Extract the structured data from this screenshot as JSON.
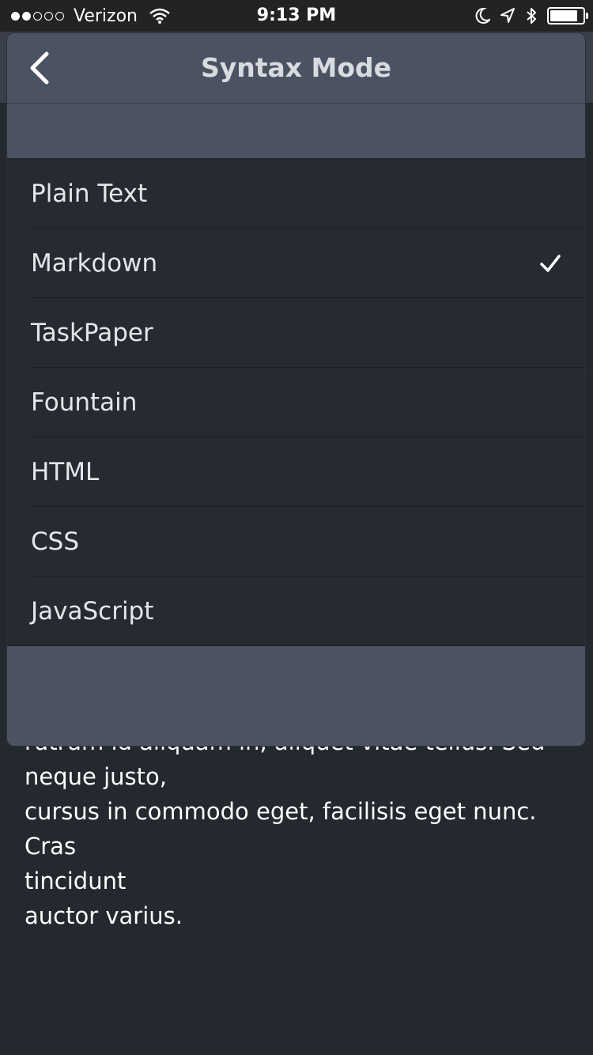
{
  "status_bar": {
    "carrier": "Verizon",
    "time": "9:13 PM",
    "signal_bars_filled": 2,
    "signal_bars_total": 5,
    "icons": [
      "wifi-icon",
      "moon-icon",
      "location-icon",
      "bluetooth-icon",
      "battery-icon"
    ]
  },
  "popover": {
    "title": "Syntax Mode",
    "back_icon": "chevron-left-icon",
    "options": [
      {
        "label": "Plain Text",
        "selected": false
      },
      {
        "label": "Markdown",
        "selected": true
      },
      {
        "label": "TaskPaper",
        "selected": false
      },
      {
        "label": "Fountain",
        "selected": false
      },
      {
        "label": "HTML",
        "selected": false
      },
      {
        "label": "CSS",
        "selected": false
      },
      {
        "label": "JavaScript",
        "selected": false
      }
    ],
    "check_icon": "checkmark-icon"
  },
  "document": {
    "lines": [
      "rutrum id aliquam in, aliquet vitae tellus. Sed",
      "neque justo,",
      "cursus in commodo eget, facilisis eget nunc. Cras",
      "tincidunt",
      "auctor varius."
    ]
  },
  "colors": {
    "background": "#24282f",
    "popover": "#4b5262",
    "list": "#272b31",
    "text": "#ffffff"
  }
}
